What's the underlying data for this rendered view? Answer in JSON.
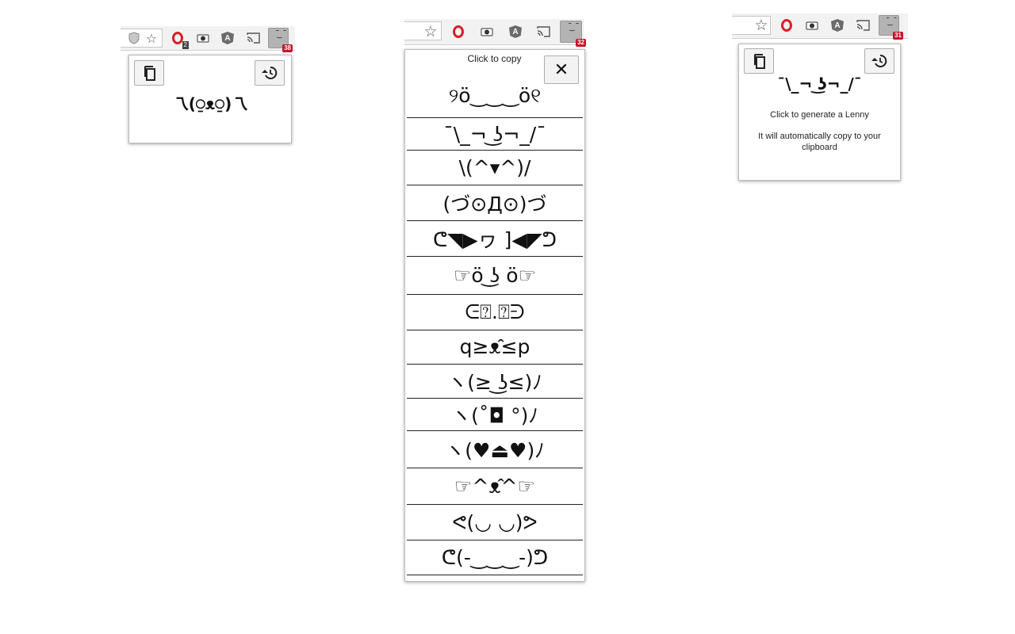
{
  "left_panel": {
    "badge": "38",
    "opera_badge": "2",
    "current_face": "乁(⍜ᴥ⍜)乁"
  },
  "middle_panel": {
    "badge": "32",
    "hint": "Click to copy",
    "close_label": "✕",
    "faces": [
      "୨ö‿‿‿ö୧",
      "¯\\_¬ ͜ʖ¬_/¯",
      "\\(^▾^)/",
      "(づ⊙Д⊙)づ",
      "ᕦ◥▶ヮ ]◀◤ᕤ",
      "☞ö ͜ʖ ö☞",
      "ᕮ⍰.⍰ᕭ",
      "q≥ᴥ̂≤p",
      "ヽ(≥ ͜ʖ≤)ﾉ",
      "ヽ(˚◘ °)ﾉ",
      "ヽ(♥⏏♥)ﾉ",
      "☞^ᴥ̂^☞",
      "ᕙ(◡ ◡)ᕗ",
      "ᕦ(-‿‿‿-)ᕤ"
    ]
  },
  "right_panel": {
    "badge": "31",
    "current_face": "¯\\_¬ ͜ʖ¬_/¯",
    "hint": "Click to generate a Lenny",
    "info": "It will automatically copy to your clipboard"
  },
  "icons": {
    "copy": "copy-icon",
    "history": "history-icon",
    "star": "star-icon",
    "cast": "cast-icon",
    "camera": "camera-icon",
    "shield": "shield-icon"
  }
}
